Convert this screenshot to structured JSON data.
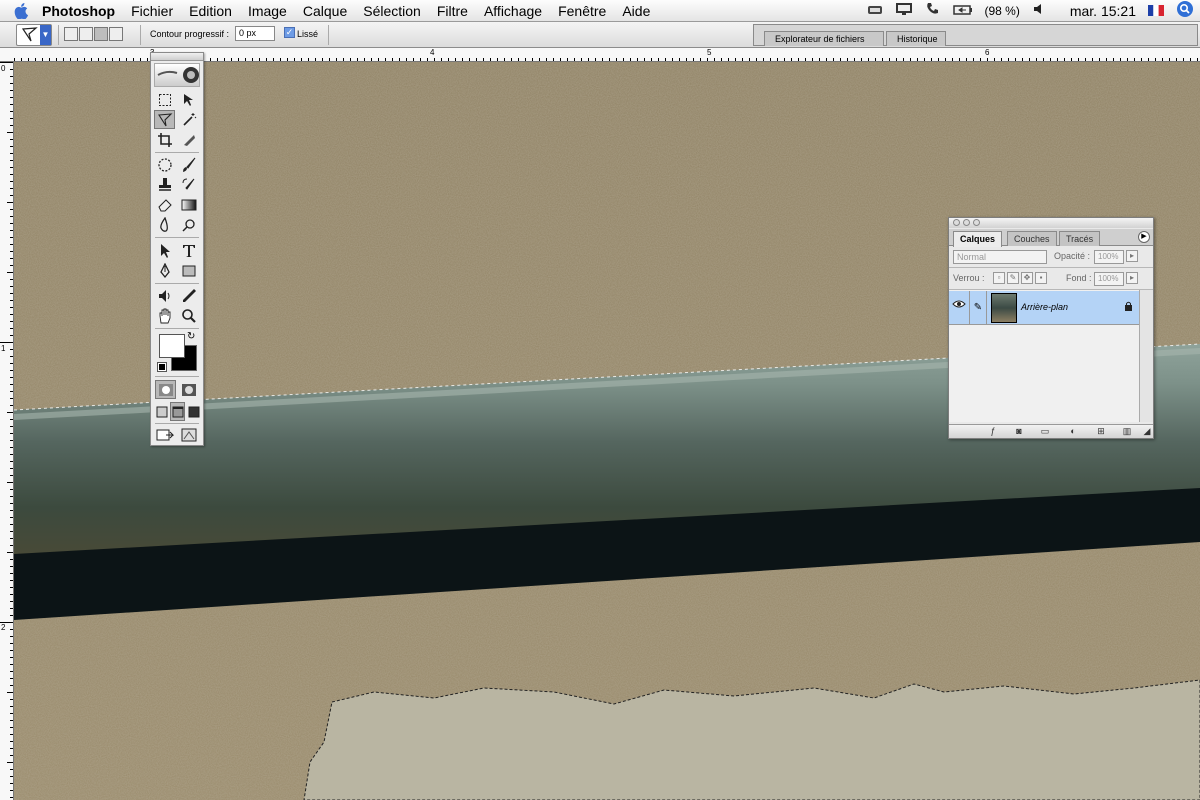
{
  "menubar": {
    "app_name": "Photoshop",
    "menus": [
      "Fichier",
      "Edition",
      "Image",
      "Calque",
      "Sélection",
      "Filtre",
      "Affichage",
      "Fenêtre",
      "Aide"
    ],
    "battery": "(98 %)",
    "clock": "mar. 15:21",
    "icons": [
      "apple-icon",
      "display-icon",
      "monitor-icon",
      "phone-icon",
      "battery-icon",
      "volume-icon",
      "flag-fr-icon",
      "spotlight-icon"
    ]
  },
  "options": {
    "feather_label": "Contour progressif :",
    "feather_value": "0 px",
    "antialias_label": "Lissé",
    "antialias_checked": true
  },
  "palette_well": {
    "tabs": [
      "Explorateur de fichiers",
      "Historique"
    ]
  },
  "rulers": {
    "top": [
      "3",
      "4",
      "5",
      "6"
    ],
    "left": [
      "0",
      "1",
      "2"
    ]
  },
  "layers_panel": {
    "tabs": [
      "Calques",
      "Couches",
      "Tracés"
    ],
    "active_tab": "Calques",
    "blend_mode": "Normal",
    "opacity_label": "Opacité :",
    "opacity_value": "100%",
    "lock_label": "Verrou :",
    "fill_label": "Fond :",
    "fill_value": "100%",
    "layers": [
      {
        "name": "Arrière-plan",
        "visible": true,
        "locked": true
      }
    ]
  },
  "colors": {
    "selection_highlight": "#b4d3f6",
    "accent": "#3a67c7"
  }
}
